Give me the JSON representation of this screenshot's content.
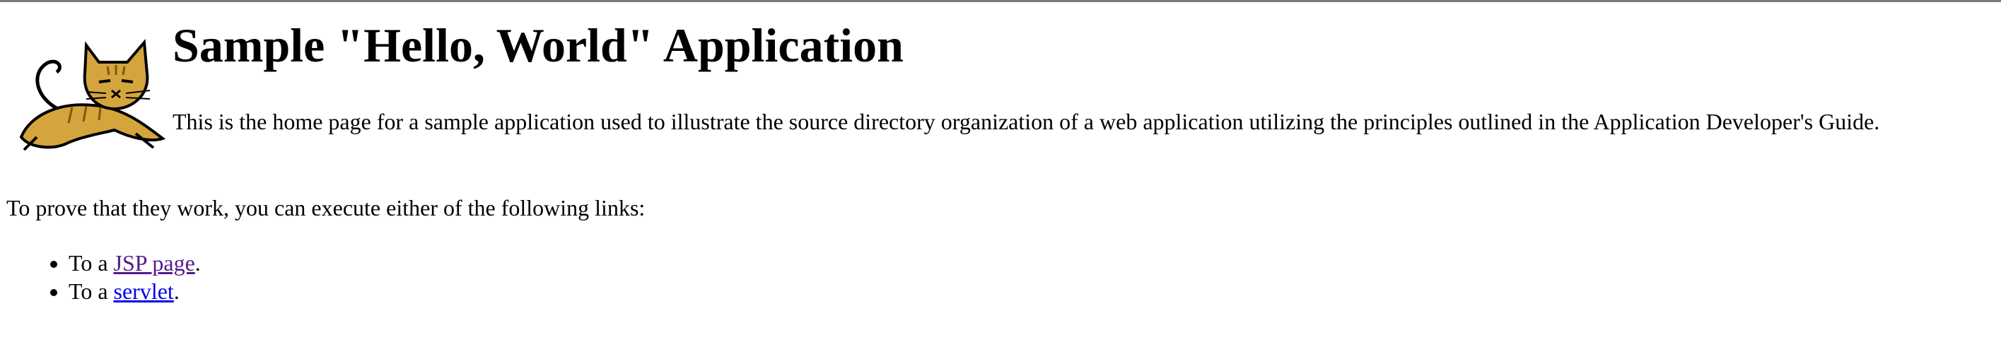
{
  "page": {
    "title": "Sample \"Hello, World\" Application",
    "intro": "This is the home page for a sample application used to illustrate the source directory organization of a web application utilizing the principles outlined in the Application Developer's Guide.",
    "prove_text": "To prove that they work, you can execute either of the following links:"
  },
  "links": [
    {
      "prefix": "To a ",
      "label": "JSP page",
      "suffix": ".",
      "visited": true
    },
    {
      "prefix": "To a ",
      "label": "servlet",
      "suffix": ".",
      "visited": false
    }
  ],
  "logo": {
    "icon": "tomcat-cat-icon"
  },
  "colors": {
    "visited_link": "#551a8b",
    "unvisited_link": "#0000ee",
    "logo_fill": "#d4a53c"
  }
}
